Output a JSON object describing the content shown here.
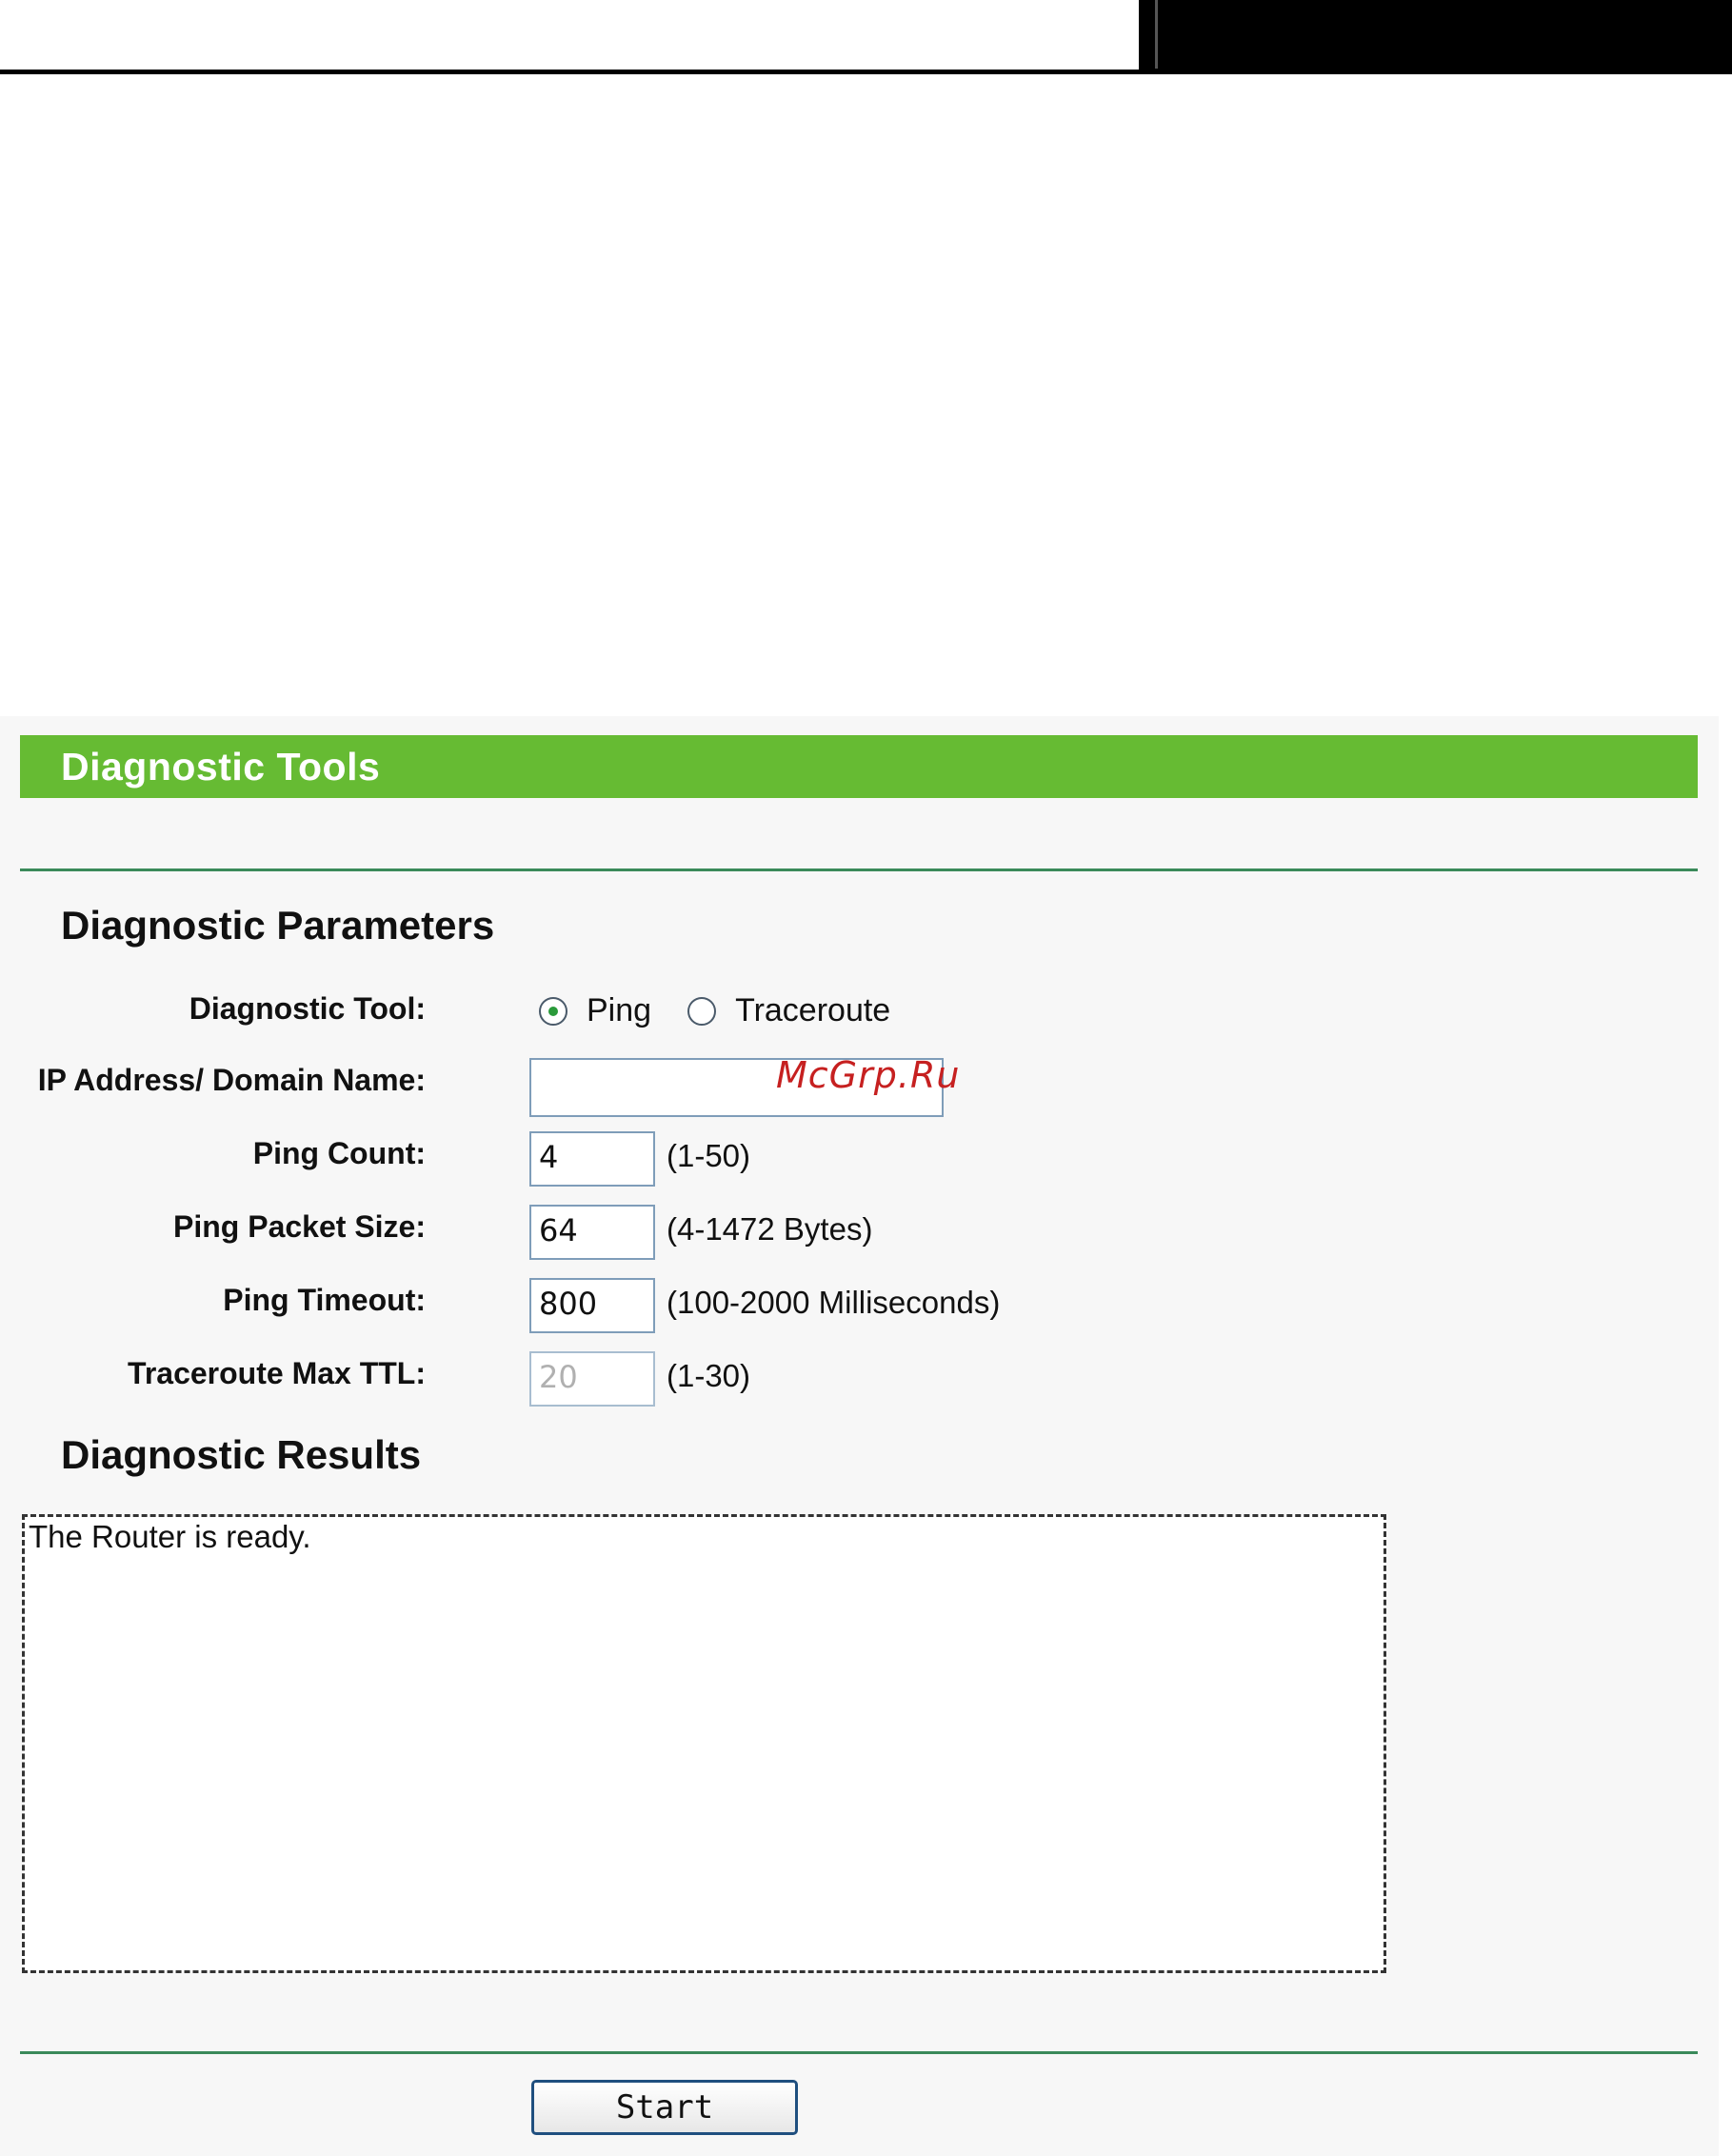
{
  "page": {
    "title": "Diagnostic Tools"
  },
  "parameters": {
    "heading": "Diagnostic Parameters",
    "diagnostic_tool": {
      "label": "Diagnostic Tool:",
      "options": [
        "Ping",
        "Traceroute"
      ],
      "selected": "Ping"
    },
    "ip_address": {
      "label": "IP Address/ Domain Name:",
      "value": ""
    },
    "ping_count": {
      "label": "Ping Count:",
      "value": "4",
      "hint": "(1-50)"
    },
    "ping_packet_size": {
      "label": "Ping Packet Size:",
      "value": "64",
      "hint": "(4-1472 Bytes)"
    },
    "ping_timeout": {
      "label": "Ping Timeout:",
      "value": "800",
      "hint": "(100-2000 Milliseconds)"
    },
    "traceroute_max_ttl": {
      "label": "Traceroute Max TTL:",
      "value": "20",
      "hint": "(1-30)",
      "disabled": true
    }
  },
  "results": {
    "heading": "Diagnostic Results",
    "text": "The Router is ready."
  },
  "actions": {
    "start_label": "Start"
  },
  "watermark": "McGrp.Ru",
  "colors": {
    "title_bar": "#66bb33",
    "divider": "#3a8a5a",
    "panel_background": "#f7f7f7",
    "radio_dot": "#2a9a3a",
    "watermark": "#c62020"
  }
}
